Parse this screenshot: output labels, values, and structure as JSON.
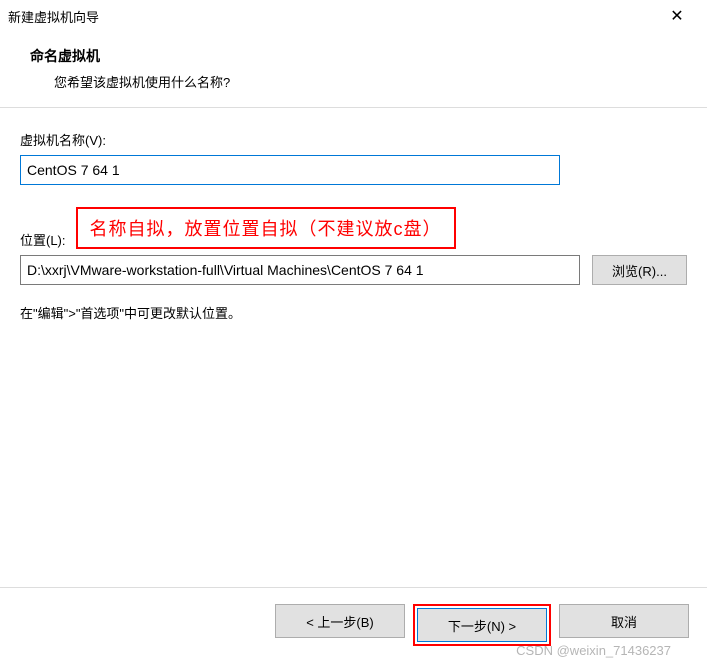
{
  "window": {
    "title": "新建虚拟机向导"
  },
  "header": {
    "title": "命名虚拟机",
    "subtitle": "您希望该虚拟机使用什么名称?"
  },
  "form": {
    "name_label": "虚拟机名称(V):",
    "name_value": "CentOS 7 64 1",
    "location_label": "位置(L):",
    "location_value": "D:\\xxrj\\VMware-workstation-full\\Virtual Machines\\CentOS 7 64 1",
    "browse_label": "浏览(R)...",
    "hint": "在\"编辑\">\"首选项\"中可更改默认位置。"
  },
  "annotation": {
    "text": "名称自拟，放置位置自拟（不建议放c盘）"
  },
  "footer": {
    "back": "< 上一步(B)",
    "next": "下一步(N) >",
    "cancel": "取消"
  },
  "watermark": "CSDN @weixin_71436237"
}
